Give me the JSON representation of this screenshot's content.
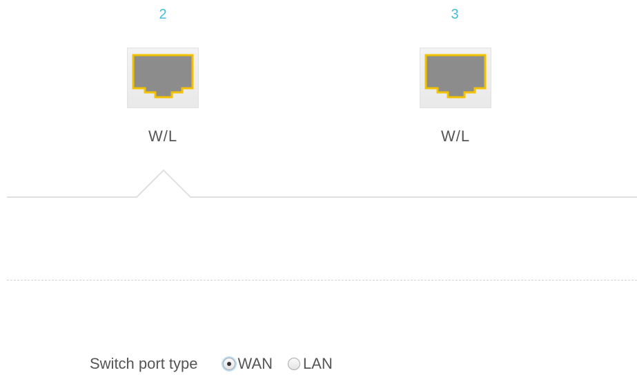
{
  "ports": [
    {
      "number": "2",
      "label": "W/L",
      "icon": "ethernet-port-icon"
    },
    {
      "number": "3",
      "label": "W/L",
      "icon": "ethernet-port-icon"
    }
  ],
  "settings": {
    "switch_port_type": {
      "label": "Switch port type",
      "options": [
        {
          "label": "WAN",
          "selected": true
        },
        {
          "label": "LAN",
          "selected": false
        }
      ]
    }
  },
  "colors": {
    "port_number": "#3fbdd6",
    "port_outline": "#f2c200",
    "port_fill": "#8c8c8c"
  }
}
